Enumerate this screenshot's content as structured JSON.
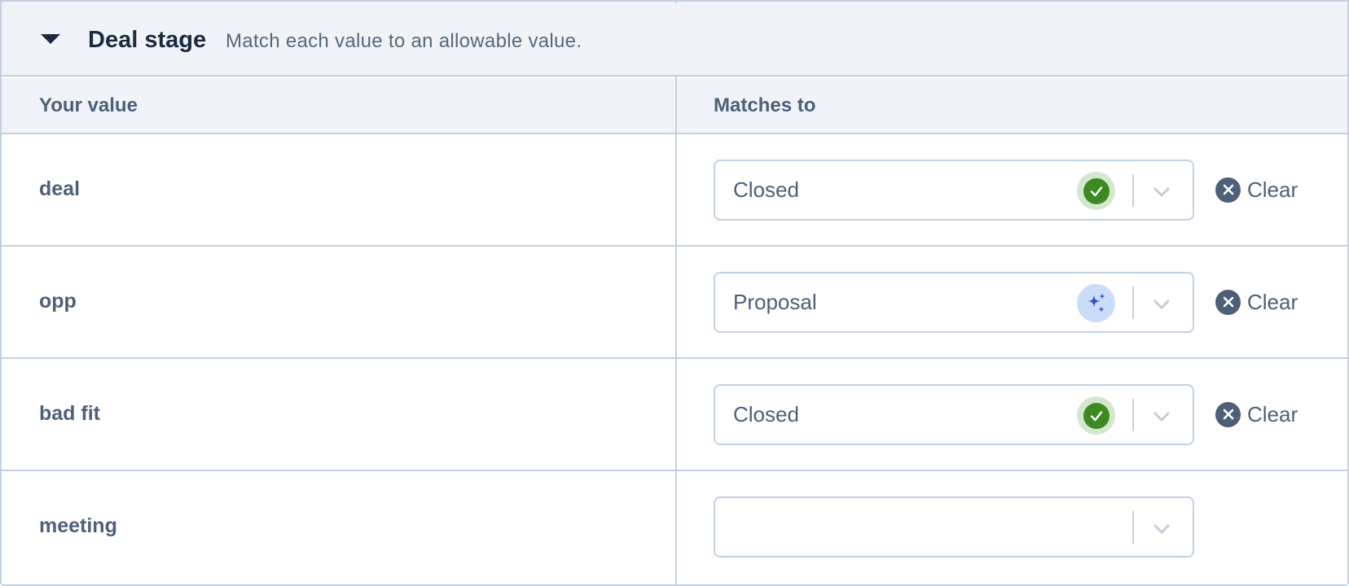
{
  "section": {
    "title": "Deal stage",
    "description": "Match each value to an allowable value."
  },
  "columns": {
    "your_value": "Your value",
    "matches_to": "Matches to"
  },
  "rows": [
    {
      "value": "deal",
      "match": "Closed",
      "status": "confirmed",
      "clear_label": "Clear"
    },
    {
      "value": "opp",
      "match": "Proposal",
      "status": "ai-suggested",
      "clear_label": "Clear"
    },
    {
      "value": "bad fit",
      "match": "Closed",
      "status": "confirmed",
      "clear_label": "Clear"
    },
    {
      "value": "meeting",
      "match": "",
      "status": "none",
      "clear_label": ""
    }
  ],
  "icons": {
    "collapse": "caret-down-icon",
    "confirmed": "check-circle-icon",
    "ai": "sparkles-icon",
    "dropdown": "chevron-down-icon",
    "clear": "x-circle-icon"
  },
  "colors": {
    "confirmed_badge": "#3d8a22",
    "ai_badge": "#2c55c8",
    "border": "#c3d1e0",
    "header_bg": "#f0f4f9"
  }
}
